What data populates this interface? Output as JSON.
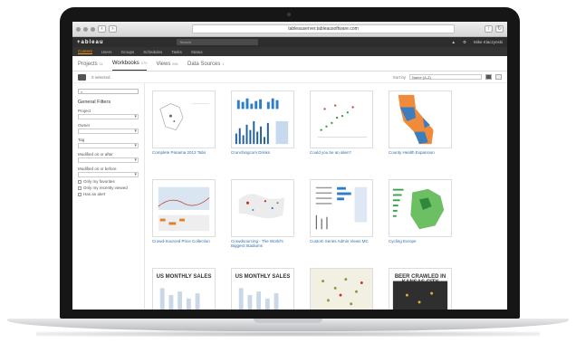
{
  "browser": {
    "url": "tableauserver.tableausoftware.com"
  },
  "header": {
    "logo": "+ableau",
    "search_placeholder": "Search",
    "user": "Mike Klaczynski"
  },
  "nav": [
    "Content",
    "Users",
    "Groups",
    "Schedules",
    "Tasks",
    "Status"
  ],
  "tabs": [
    {
      "label": "Projects",
      "count": "11"
    },
    {
      "label": "Workbooks",
      "count": "270"
    },
    {
      "label": "Views",
      "count": "891"
    },
    {
      "label": "Data Sources",
      "count": "1"
    }
  ],
  "toolbar": {
    "selected": "0 selected",
    "sort_label": "Sort by",
    "sort_value": "Name (A-Z)"
  },
  "sidebar": {
    "title": "General Filters",
    "filters": [
      "Project",
      "Owner",
      "Tag",
      "Modified on or after",
      "Modified on or before"
    ],
    "checkboxes": [
      "Only my favorites",
      "Only my recently viewed",
      "Has an alert"
    ]
  },
  "workbooks": [
    {
      "title": "Complete Panama 2013 Tabs",
      "kind": "map"
    },
    {
      "title": "Crunchingcom Drinks",
      "kind": "bars"
    },
    {
      "title": "Could you be an alien?",
      "kind": "scatter"
    },
    {
      "title": "County Health Expansion",
      "kind": "ca-map"
    },
    {
      "title": "Crowd-Sourced Price Collection",
      "kind": "heat"
    },
    {
      "title": "Crowdsourcing - The World's Biggest Stadiums",
      "kind": "world"
    },
    {
      "title": "Custom Series Admin Views MC",
      "kind": "table"
    },
    {
      "title": "Cycling Europe",
      "kind": "europe"
    },
    {
      "title": "",
      "kind": "sales",
      "caption": "US MONTHLY SALES"
    },
    {
      "title": "",
      "kind": "sales",
      "caption": "US MONTHLY SALES"
    },
    {
      "title": "",
      "kind": "dots",
      "caption": ""
    },
    {
      "title": "",
      "kind": "kc",
      "caption": "BEER CRAWLED IN KANSAS CITY"
    }
  ],
  "colors": {
    "accent": "#f39b1e",
    "link": "#2a6fb0",
    "header": "#2d2d2d"
  }
}
